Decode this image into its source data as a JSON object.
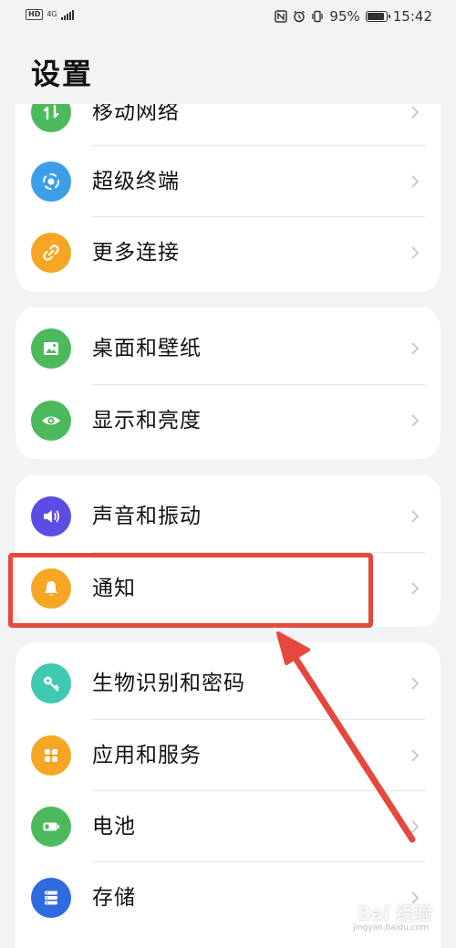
{
  "status_bar": {
    "hd": "HD",
    "network": "4G",
    "battery_percent_text": "95%",
    "battery_level": 0.95,
    "time": "15:42"
  },
  "page": {
    "title": "设置"
  },
  "groups": [
    {
      "items": [
        {
          "label": "移动网络",
          "icon": "mobile-network-icon",
          "color": "#4cba5c"
        },
        {
          "label": "超级终端",
          "icon": "super-device-icon",
          "color": "#3d9ee8"
        },
        {
          "label": "更多连接",
          "icon": "link-icon",
          "color": "#f5a623"
        }
      ]
    },
    {
      "items": [
        {
          "label": "桌面和壁纸",
          "icon": "wallpaper-icon",
          "color": "#4cba5c"
        },
        {
          "label": "显示和亮度",
          "icon": "eye-icon",
          "color": "#4cba5c"
        }
      ]
    },
    {
      "items": [
        {
          "label": "声音和振动",
          "icon": "speaker-icon",
          "color": "#5b4de3"
        },
        {
          "label": "通知",
          "icon": "bell-icon",
          "color": "#f5a623"
        }
      ]
    },
    {
      "items": [
        {
          "label": "生物识别和密码",
          "icon": "key-icon",
          "color": "#3fc9b0"
        },
        {
          "label": "应用和服务",
          "icon": "apps-grid-icon",
          "color": "#f5a623"
        },
        {
          "label": "电池",
          "icon": "battery-icon",
          "color": "#4cba5c"
        },
        {
          "label": "存储",
          "icon": "storage-icon",
          "color": "#2f6be0"
        }
      ]
    }
  ],
  "colors": {
    "background": "#f1f3f5",
    "card": "#ffffff",
    "annotation": "#e5483d"
  },
  "watermark": {
    "text": "Bai 经验",
    "sub": "jingyan.baidu.com"
  }
}
